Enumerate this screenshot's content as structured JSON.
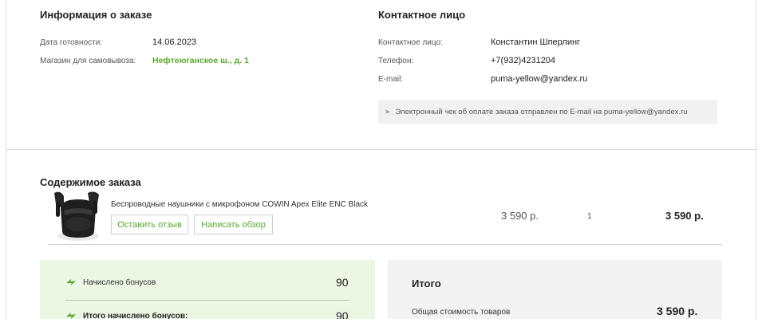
{
  "order_info": {
    "title": "Информация о заказе",
    "ready_date_label": "Дата готовности:",
    "ready_date_value": "14.06.2023",
    "pickup_store_label": "Магазин для самовывоза:",
    "pickup_store_value": "Нефтеюганское ш., д. 1"
  },
  "contact": {
    "title": "Контактное лицо",
    "person_label": "Контактное лицо:",
    "person_value": "Константин Шперлинг",
    "phone_label": "Телефон:",
    "phone_value": "+7(932)4231204",
    "email_label": "E-mail:",
    "email_value": "puma-yellow@yandex.ru",
    "receipt_notice": "Электронный чек об оплате заказа отправлен по E-mail на puma-yellow@yandex.ru"
  },
  "contents": {
    "title": "Содержимое заказа",
    "items": [
      {
        "name": "Беспроводные наушники с микрофоном COWIN Apex Elite ENC Black",
        "review_button": "Оставить отзыв",
        "write_review_button": "Написать обзор",
        "price": "3 590 р.",
        "quantity": "1",
        "total": "3 590 р."
      }
    ]
  },
  "bonuses": {
    "accrued_label": "Начислено бонусов",
    "accrued_value": "90",
    "total_accrued_label": "Итого начислено бонусов:",
    "total_accrued_value": "90"
  },
  "summary": {
    "title": "Итого",
    "goods_cost_label": "Общая стоимость товаров",
    "goods_cost_value": "3 590 р."
  },
  "colors": {
    "accent_green": "#5aa82e",
    "bonus_panel_bg": "#ebf6e3",
    "summary_panel_bg": "#f3f3f3"
  }
}
